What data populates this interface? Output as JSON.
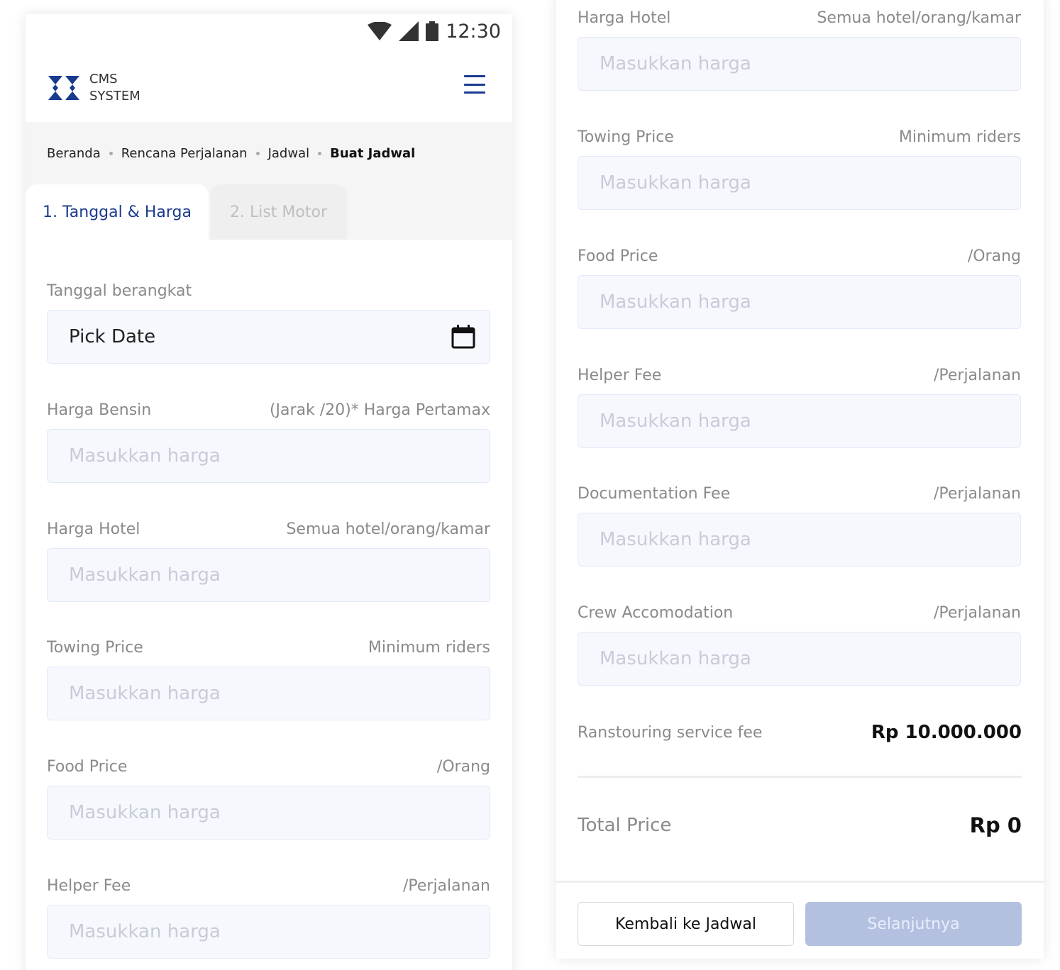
{
  "status_bar": {
    "time": "12:30",
    "icons": [
      "wifi-icon",
      "signal-icon",
      "battery-icon"
    ]
  },
  "app": {
    "logo_line1": "CMS",
    "logo_line2": "SYSTEM",
    "brand_color": "#1a3a8f"
  },
  "breadcrumb": [
    "Beranda",
    "Rencana Perjalanan",
    "Jadwal",
    "Buat Jadwal"
  ],
  "tabs": [
    {
      "label": "1. Tanggal & Harga",
      "active": true
    },
    {
      "label": "2. List Motor",
      "active": false
    }
  ],
  "form": {
    "date": {
      "label": "Tanggal berangkat",
      "value": "Pick Date",
      "icon": "calendar-icon"
    },
    "fields": [
      {
        "label": "Harga Bensin",
        "hint": "(Jarak /20)* Harga Pertamax",
        "placeholder": "Masukkan harga"
      },
      {
        "label": "Harga Hotel",
        "hint": "Semua hotel/orang/kamar",
        "placeholder": "Masukkan harga"
      },
      {
        "label": "Towing Price",
        "hint": "Minimum riders",
        "placeholder": "Masukkan harga"
      },
      {
        "label": "Food Price",
        "hint": "/Orang",
        "placeholder": "Masukkan harga"
      },
      {
        "label": "Helper Fee",
        "hint": "/Perjalanan",
        "placeholder": "Masukkan harga"
      },
      {
        "label": "Documentation Fee",
        "hint": "/Perjalanan",
        "placeholder": "Masukkan harga"
      },
      {
        "label": "Crew Accomodation",
        "hint": "/Perjalanan",
        "placeholder": "Masukkan harga"
      }
    ]
  },
  "summary": {
    "service_fee_label": "Ranstouring service fee",
    "service_fee_value": "Rp 10.000.000",
    "total_label": "Total Price",
    "total_value": "Rp 0"
  },
  "buttons": {
    "back": "Kembali ke Jadwal",
    "next": "Selanjutnya"
  }
}
